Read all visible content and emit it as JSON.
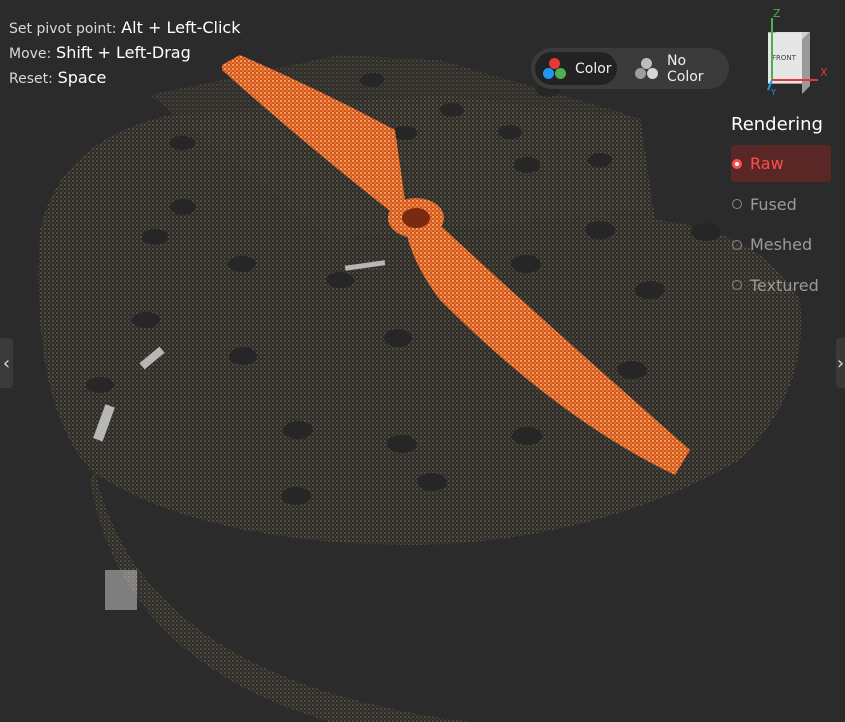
{
  "hints": [
    {
      "key": "Set pivot point:",
      "value": "Alt + Left-Click"
    },
    {
      "key": "Move:",
      "value": "Shift + Left-Drag"
    },
    {
      "key": "Reset:",
      "value": "Space"
    }
  ],
  "color_toggle": {
    "color_label": "Color",
    "nocolor_label": "No Color",
    "selected": "Color"
  },
  "gizmo": {
    "face_label": "FRONT",
    "axis_z": "Z",
    "axis_x": "X",
    "axis_y": "Y",
    "colors": {
      "z": "#4caf50",
      "x": "#e53935",
      "y": "#2196f3"
    }
  },
  "rendering": {
    "title": "Rendering",
    "selected": "Raw",
    "options": [
      {
        "label": "Raw"
      },
      {
        "label": "Fused"
      },
      {
        "label": "Meshed"
      },
      {
        "label": "Textured"
      }
    ]
  },
  "nav": {
    "prev_icon": "chevron-left-icon",
    "next_icon": "chevron-right-icon",
    "prev_glyph": "‹",
    "next_glyph": "›"
  },
  "colors": {
    "accent": "#ff4d4d",
    "propeller": "#f07a3a",
    "background": "#2b2b2b"
  }
}
